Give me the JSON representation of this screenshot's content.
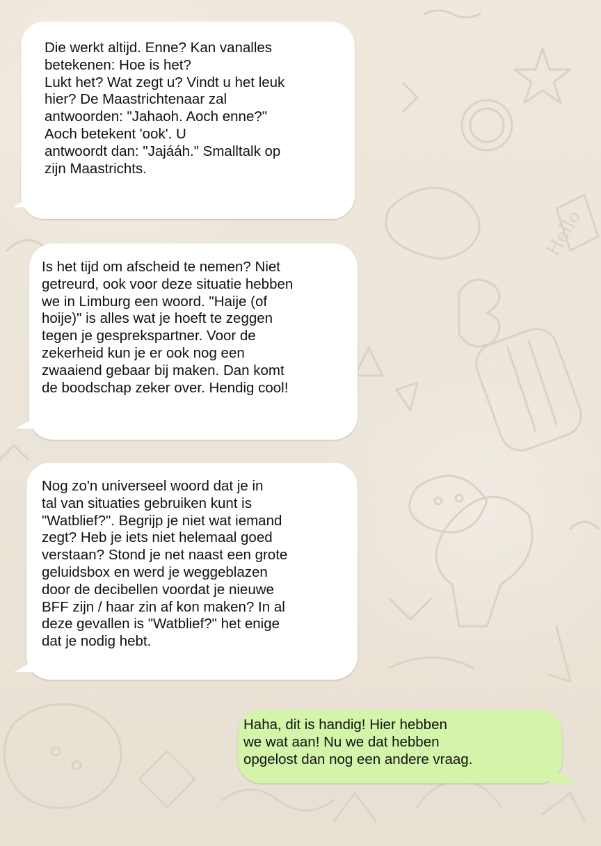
{
  "chat": {
    "messages": [
      {
        "direction": "incoming",
        "text": "Die werkt altijd. Enne? Kan vanalles\nbetekenen: Hoe is het?\nLukt het? Wat zegt u? Vindt u het leuk\nhier? De Maastrichtenaar zal\nantwoorden: \"Jahaoh. Aoch enne?\"\nAoch betekent 'ook'. U\nantwoordt dan: \"Jajááh.\" Smalltalk op\nzijn Maastrichts."
      },
      {
        "direction": "incoming",
        "text": "Is het tijd om afscheid te nemen? Niet\ngetreurd, ook voor deze situatie hebben\nwe in Limburg een woord. \"Haije (of\nhoije)\" is alles wat je hoeft te zeggen\ntegen je gesprekspartner. Voor de\nzekerheid kun je er ook nog een\nzwaaiend gebaar bij maken. Dan komt\nde boodschap zeker over. Hendig cool!"
      },
      {
        "direction": "incoming",
        "text": " Nog zo'n universeel woord dat je in\ntal van situaties gebruiken kunt is\n\"Watblief?\". Begrijp je niet wat iemand\nzegt? Heb je iets niet helemaal goed\nverstaan? Stond je net naast een grote\ngeluidsbox en werd je weggeblazen\ndoor de decibellen voordat je nieuwe\nBFF zijn / haar zin af kon maken? In al\ndeze gevallen is \"Watblief?\" het enige\n  dat je nodig hebt."
      },
      {
        "direction": "outgoing",
        "text": "   Haha, dit is handig! Hier hebben\nwe wat aan! Nu we dat hebben\n opgelost dan nog een andere vraag."
      }
    ],
    "colors": {
      "incoming_bubble": "#ffffff",
      "outgoing_bubble": "#d4f5a9",
      "background": "#ece4d8"
    }
  }
}
